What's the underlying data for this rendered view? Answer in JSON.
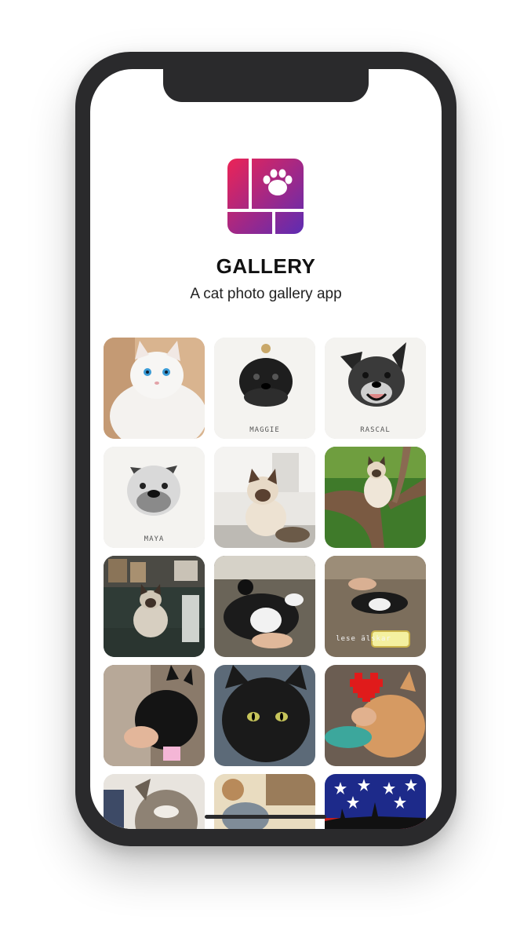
{
  "app": {
    "title": "GALLERY",
    "subtitle": "A cat photo gallery app",
    "icon": "paw-logo-icon"
  },
  "colors": {
    "brand_gradient_start": "#e0245e",
    "brand_gradient_end": "#6a2bb0",
    "phone_frame": "#2a2a2c"
  },
  "gallery": {
    "tiles": [
      {
        "name": "white-persian-cat-photo",
        "caption": ""
      },
      {
        "name": "maggie-dog-sketch",
        "caption": "MAGGIE"
      },
      {
        "name": "rascal-dog-sketch",
        "caption": "RASCAL"
      },
      {
        "name": "maya-bulldog-sketch",
        "caption": "MAYA"
      },
      {
        "name": "siamese-kitten-photo",
        "caption": ""
      },
      {
        "name": "siamese-cat-in-tree-photo",
        "caption": ""
      },
      {
        "name": "siamese-cat-on-shelf-photo",
        "caption": ""
      },
      {
        "name": "tuxedo-cat-on-couch-photo",
        "caption": ""
      },
      {
        "name": "tuxedo-cat-with-tag-photo",
        "caption": "lese älskar"
      },
      {
        "name": "black-cat-lap-photo",
        "caption": ""
      },
      {
        "name": "black-cat-closeup-photo",
        "caption": ""
      },
      {
        "name": "orange-cat-pixel-heart-photo",
        "caption": ""
      },
      {
        "name": "tabby-cat-photo",
        "caption": ""
      },
      {
        "name": "cat-with-teddy-bear-photo",
        "caption": ""
      },
      {
        "name": "flag-stars-skyline-photo",
        "caption": ""
      }
    ]
  }
}
